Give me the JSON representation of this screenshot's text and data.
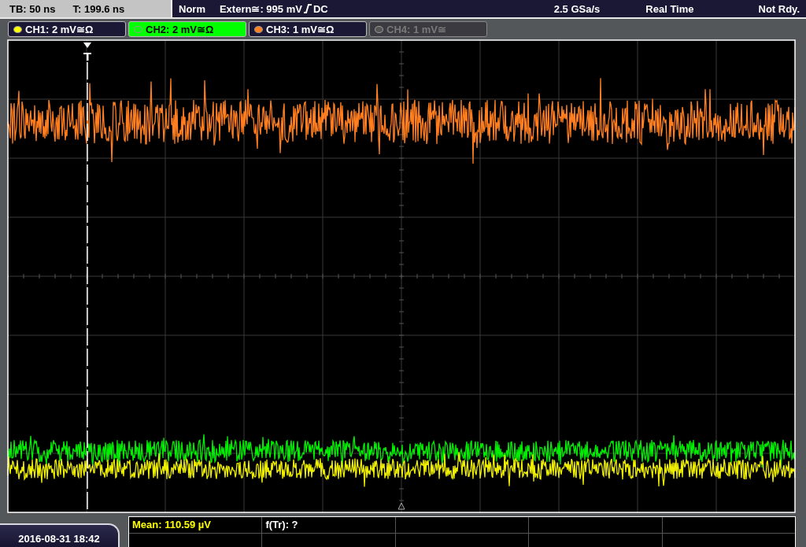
{
  "status_bar": {
    "timebase": "TB: 50 ns",
    "trigger_time": "T: 199.6 ns",
    "trigger_mode": "Norm",
    "trigger_source": "Extern≅: 995 mV",
    "trigger_coupling": "DC",
    "sample_rate": "2.5 GSa/s",
    "acquisition": "Real Time",
    "state": "Not Rdy."
  },
  "channels": [
    {
      "label": "CH1: 2 mV≅Ω",
      "color": "#ffff00",
      "selected": false,
      "disabled": false
    },
    {
      "label": "CH2: 2 mV≅Ω",
      "color": "#00ff00",
      "selected": true,
      "disabled": false
    },
    {
      "label": "CH3: 1 mV≅Ω",
      "color": "#ff8020",
      "selected": false,
      "disabled": false
    },
    {
      "label": "CH4: 1 mV≅",
      "color": "#555555",
      "selected": false,
      "disabled": true
    }
  ],
  "measurements": [
    {
      "text": "Mean: 110.59 µV",
      "color": "#ffff00"
    },
    {
      "text": "f(Tr): ?",
      "color": "#ffffff"
    }
  ],
  "timestamp": "2016-08-31 18:42"
}
